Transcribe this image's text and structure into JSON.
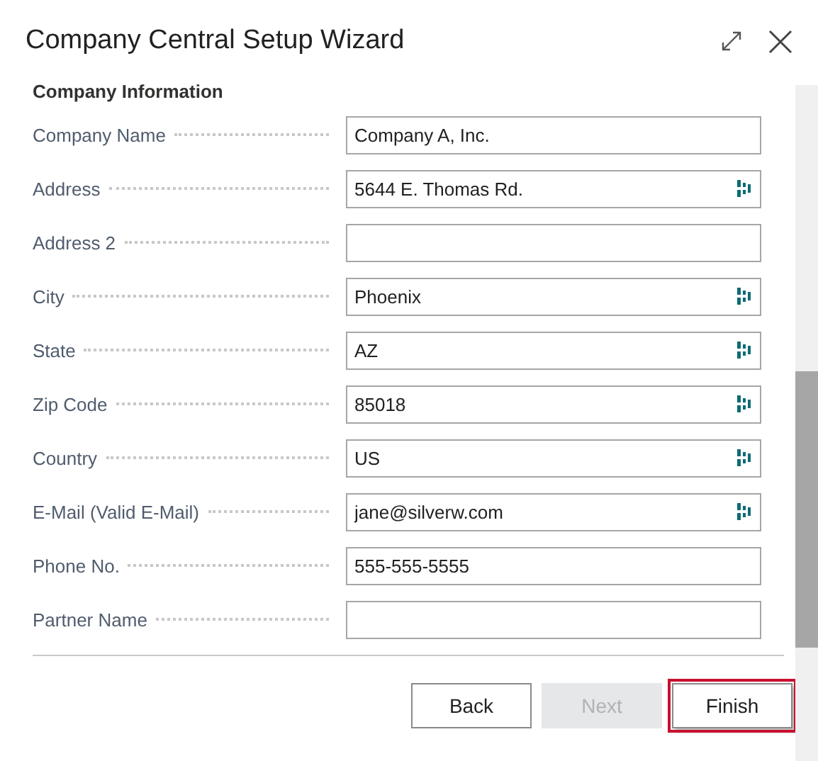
{
  "window": {
    "title": "Company Central Setup Wizard"
  },
  "section": {
    "title": "Company Information"
  },
  "fields": [
    {
      "label": "Company Name",
      "value": "Company A, Inc.",
      "lookup": false
    },
    {
      "label": "Address",
      "value": "5644 E. Thomas Rd.",
      "lookup": true
    },
    {
      "label": "Address 2",
      "lookup": false
    },
    {
      "label": "City",
      "value": "Phoenix",
      "lookup": true
    },
    {
      "label": "State",
      "value": "AZ",
      "lookup": true
    },
    {
      "label": "Zip Code",
      "value": "85018",
      "lookup": true
    },
    {
      "label": "Country",
      "value": "US",
      "lookup": true
    },
    {
      "label": "E-Mail (Valid E-Mail)",
      "value": "jane@silverw.com",
      "lookup": true
    },
    {
      "label": "Phone No.",
      "value": "555-555-5555",
      "lookup": false
    },
    {
      "label": "Partner Name",
      "lookup": false
    }
  ],
  "buttons": [
    {
      "label": "Back",
      "disabled": false,
      "highlighted": false
    },
    {
      "label": "Next",
      "disabled": true,
      "highlighted": false
    },
    {
      "label": "Finish",
      "disabled": false,
      "highlighted": true
    }
  ]
}
